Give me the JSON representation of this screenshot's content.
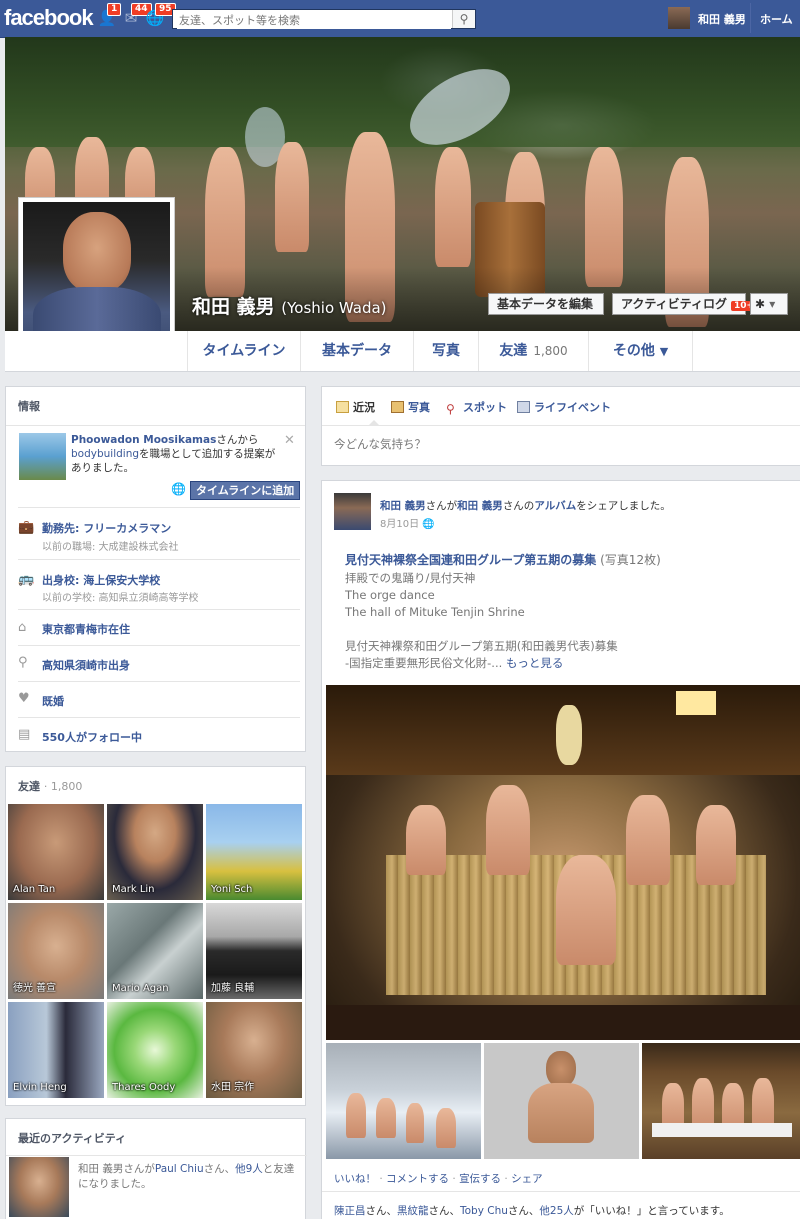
{
  "topbar": {
    "logo": "facebook",
    "friend_requests": "1",
    "messages": "44",
    "notifications": "95",
    "search_placeholder": "友達、スポット等を検索",
    "user_name": "和田 義男",
    "home": "ホーム"
  },
  "profile": {
    "name": "和田 義男",
    "name_en": "(Yoshio Wada)",
    "edit_button": "基本データを編集",
    "activity_log": "アクティビティログ",
    "activity_badge": "10+",
    "gear": "✱"
  },
  "tabs": [
    {
      "label": "タイムライン"
    },
    {
      "label": "基本データ"
    },
    {
      "label": "写真"
    },
    {
      "label": "友達",
      "count": "1,800"
    },
    {
      "label": "その他"
    }
  ],
  "info": {
    "title": "情報",
    "suggestion": {
      "name": "Phoowadon Moosikamas",
      "text1": "さんから",
      "link": "bodybuilding",
      "text2": "を職場として追加する提案がありました。",
      "button": "タイムラインに追加"
    },
    "rows": [
      {
        "icon": "briefcase-icon",
        "title": "勤務先: フリーカメラマン",
        "sub": "以前の職場: 大成建設株式会社"
      },
      {
        "icon": "school-icon",
        "title": "出身校: 海上保安大学校",
        "sub": "以前の学校: 高知県立須崎高等学校"
      },
      {
        "icon": "house-icon",
        "title": "東京都青梅市在住",
        "sub": ""
      },
      {
        "icon": "pin-icon",
        "title": "高知県須崎市出身",
        "sub": ""
      },
      {
        "icon": "heart-icon",
        "title": "既婚",
        "sub": ""
      },
      {
        "icon": "rss-icon",
        "title": "550人がフォロー中",
        "sub": ""
      }
    ]
  },
  "friends": {
    "title": "友達",
    "count": "· 1,800",
    "list": [
      {
        "name": "Alan Tan"
      },
      {
        "name": "Mark Lin"
      },
      {
        "name": "Yoni Sch"
      },
      {
        "name": "徳光 善宣"
      },
      {
        "name": "Mario Agan"
      },
      {
        "name": "加藤 良輔"
      },
      {
        "name": "Elvin Heng"
      },
      {
        "name": "Thares Oody"
      },
      {
        "name": "水田 宗作"
      }
    ]
  },
  "recent": {
    "title": "最近のアクティビティ",
    "user": "和田 義男",
    "t1": "さんが",
    "friend": "Paul Chiu",
    "t2": "さん、",
    "others": "他9人",
    "t3": "と友達になりました。"
  },
  "composer": {
    "tabs": [
      "近況",
      "写真",
      "スポット",
      "ライフイベント"
    ],
    "placeholder": "今どんな気持ち？"
  },
  "post": {
    "author": "和田 義男",
    "t1": "さんが",
    "owner": "和田 義男",
    "t2": "さんの",
    "album_word": "アルバム",
    "t3": "をシェアしました。",
    "date": "8月10日",
    "album_title": "見付天神裸祭全国連和田グループ第五期の募集",
    "photo_count": "(写真12枚)",
    "lines": [
      "拝殿での鬼踊り/見付天神",
      "The orge dance",
      "The hall of Mituke Tenjin Shrine"
    ],
    "desc1": "見付天神裸祭和田グループ第五期(和田義男代表)募集",
    "desc2": "-国指定重要無形民俗文化財-...",
    "more": "もっと見る",
    "actions": {
      "like": "いいね！",
      "comment": "コメントする",
      "share_promote": "宣伝する",
      "share": "シェア",
      "sep": "·"
    },
    "likes": {
      "n1": "陳正昌",
      "t1": "さん、",
      "n2": "黒紋龍",
      "t2": "さん、",
      "n3": "Toby Chu",
      "t3": "さん、",
      "others": "他25人",
      "t4": "が「いいね！」と言っています。"
    }
  }
}
